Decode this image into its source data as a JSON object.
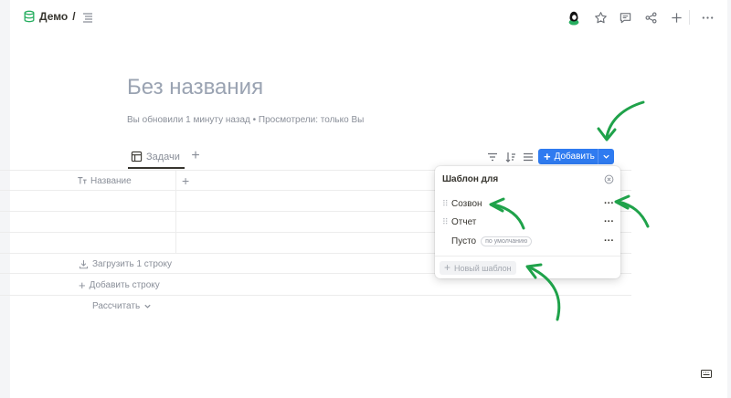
{
  "breadcrumb": {
    "workspace": "Демо",
    "separator": "/"
  },
  "page": {
    "title": "Без названия",
    "meta": "Вы обновили 1 минуту назад  • Просмотрели: только Вы"
  },
  "view": {
    "tab_label": "Задачи",
    "add_button_label": "Добавить"
  },
  "table": {
    "column_header": "Название",
    "footer": {
      "upload": "Загрузить 1 строку",
      "add_row": "Добавить строку",
      "calculate": "Рассчитать"
    }
  },
  "template_popup": {
    "title": "Шаблон для",
    "templates": [
      {
        "name": "Созвон",
        "badge": ""
      },
      {
        "name": "Отчет",
        "badge": ""
      },
      {
        "name": "Пусто",
        "badge": "по умолчанию"
      }
    ],
    "new_template": "Новый шаблон"
  },
  "colors": {
    "accent": "#2f7bf0",
    "arrow": "#1fa24a",
    "db_icon": "#27ae60"
  },
  "icons": [
    "database-icon",
    "toc-icon",
    "avatar",
    "star-icon",
    "comment-icon",
    "share-icon",
    "plus-icon",
    "more-icon",
    "table-icon",
    "filter-icon",
    "sort-icon",
    "settings-icon",
    "text-type-icon",
    "download-icon",
    "close-circle-icon",
    "grip-icon",
    "keyboard-icon"
  ]
}
